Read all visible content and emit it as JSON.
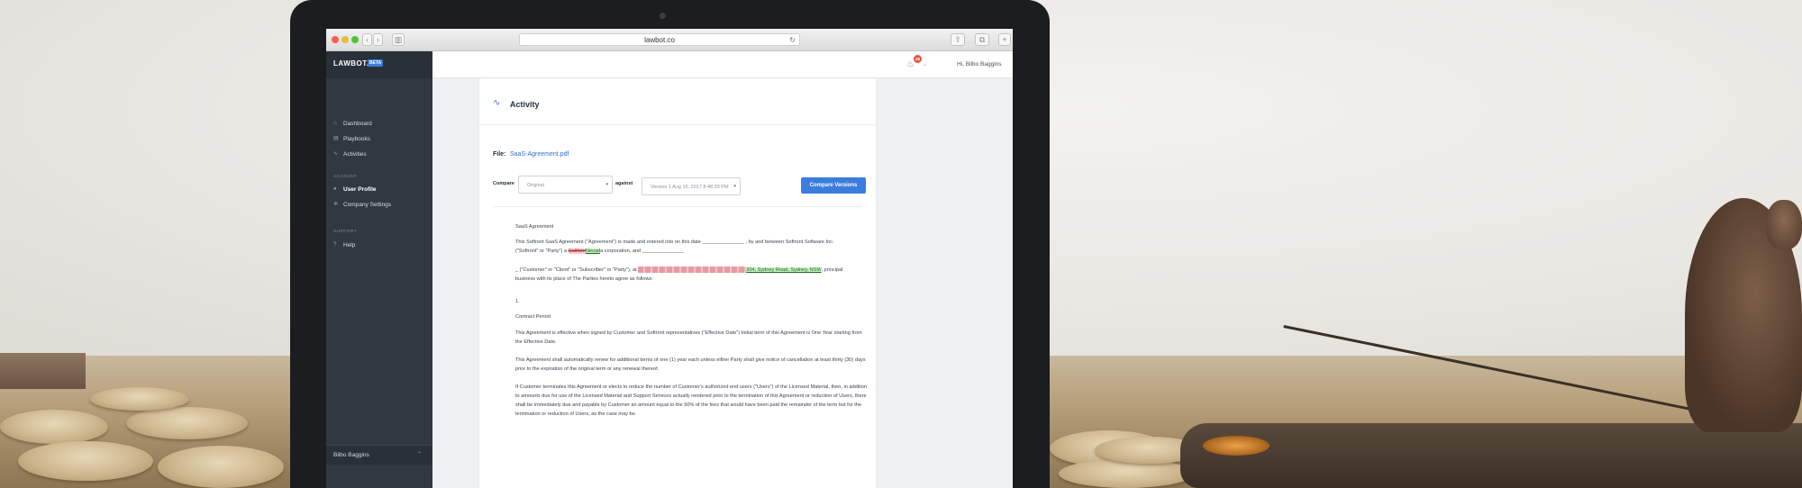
{
  "browser": {
    "url": "lawbot.co",
    "back_symbol": "‹",
    "forward_symbol": "›",
    "sidebar_toggle_symbol": "▥",
    "reload_symbol": "↻",
    "share_symbol": "⇧",
    "tabs_symbol": "⧉",
    "new_tab_symbol": "+"
  },
  "sidebar": {
    "brand": "LAWBOT.AI",
    "badge": "BETA",
    "nav": [
      {
        "label": "Dashboard",
        "icon": "home-icon",
        "glyph": "⌂"
      },
      {
        "label": "Playbooks",
        "icon": "book-icon",
        "glyph": "▤"
      },
      {
        "label": "Activities",
        "icon": "activity-icon",
        "glyph": "∿"
      }
    ],
    "account_heading": "ACCOUNT",
    "account": [
      {
        "label": "User Profile",
        "icon": "user-icon",
        "glyph": "●"
      },
      {
        "label": "Company Settings",
        "icon": "gear-icon",
        "glyph": "✲"
      }
    ],
    "support_heading": "SUPPORT",
    "support": [
      {
        "label": "Help",
        "icon": "help-icon",
        "glyph": "?"
      }
    ],
    "footer_user": "Bilbo Baggins",
    "footer_caret": "⌃"
  },
  "topbar": {
    "bell_glyph": "🔔",
    "notifications_count": "48",
    "caret": "⌄",
    "greeting": "Hi, Bilbo Baggins"
  },
  "activity": {
    "title": "Activity",
    "icon_glyph": "∿",
    "file_label": "File:",
    "file_name": "SaaS-Agreement.pdf",
    "compare_label": "Compare",
    "compare_value": "Original",
    "against_label": "against",
    "against_value": "Version 1 Aug 16, 2017 8:48:39 PM",
    "select_arrow": "▾",
    "button": "Compare Versions"
  },
  "document": {
    "title": "SaaS Agreement",
    "p1a": "This Softront SaaS Agreement (\"Agreement\") is made and entered into on this date _______________ , by and between Softront Software Inc.",
    "p1b": "(\"Softront\" or \"Party\") a ",
    "p1_del": "Californ",
    "p1_ins": "Nevad",
    "p1c": "a corporation, and _______________",
    "p2a": "_ (\"Customer\" or \"Client\" or \"Subscriber\" or \"Party\"), at ",
    "p2_ins": "204, Sydney Road, Sydney, NSW",
    "p2b": ", principal",
    "p2c": "business with its place of The Parties hereto agree as follows:",
    "num": "1.",
    "section": "Contract Period",
    "p3": "This Agreement is effective when signed by Customer and Softront representatives (\"Effective Date\") Initial term of this Agreement is One Year starting from the Effective Date.",
    "p4": "This Agreement shall automatically renew for additional terms of one (1) year each unless either Party shall give notice of cancellation at least thirty (30) days prior to the expiration of the original term or any renewal thereof.",
    "p5": "If Customer terminates this Agreement or elects to reduce the number of Customer's authorized end users (\"Users\") of the Licensed Material, then, in addition to amounts due for use of the Licensed Material and Support Services actually rendered prior to the termination of this Agreement or reduction of Users, there shall be immediately due and payable by Customer an amount equal to the 50% of the fees that would have been paid the remainder of the term but for the termination or reduction of Users, as the case may be."
  }
}
